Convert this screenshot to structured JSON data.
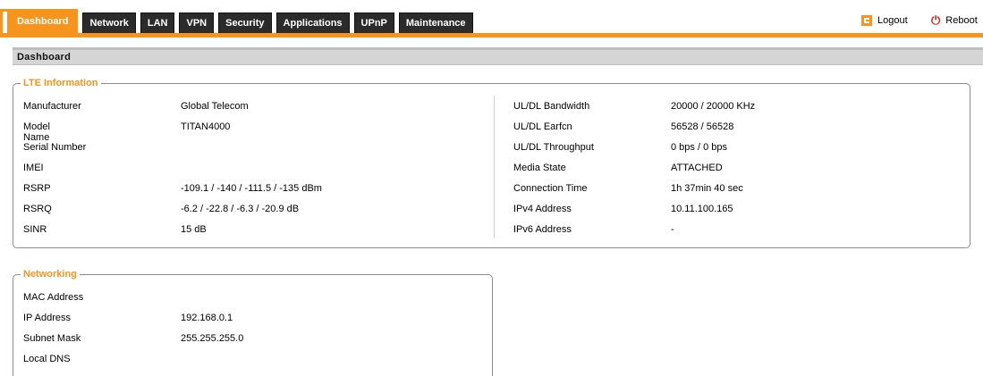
{
  "nav": {
    "tabs": [
      "Dashboard",
      "Network",
      "LAN",
      "VPN",
      "Security",
      "Applications",
      "UPnP",
      "Maintenance"
    ],
    "active_tab": "Dashboard",
    "logout_label": "Logout",
    "reboot_label": "Reboot"
  },
  "page": {
    "section_title": "Dashboard"
  },
  "lte": {
    "legend": "LTE Information",
    "left": [
      {
        "label": "Manufacturer",
        "value": "Global Telecom"
      },
      {
        "label": "Model Name",
        "value": "TITAN4000"
      },
      {
        "label": "Serial Number",
        "value": ""
      },
      {
        "label": "IMEI",
        "value": ""
      },
      {
        "label": "RSRP",
        "value": "-109.1 / -140 / -111.5 / -135 dBm"
      },
      {
        "label": "RSRQ",
        "value": "-6.2 / -22.8 / -6.3 / -20.9 dB"
      },
      {
        "label": "SINR",
        "value": "15 dB"
      }
    ],
    "right": [
      {
        "label": "UL/DL Bandwidth",
        "value": "20000 / 20000 KHz"
      },
      {
        "label": "UL/DL Earfcn",
        "value": "56528 / 56528"
      },
      {
        "label": "UL/DL Throughput",
        "value": "0 bps / 0 bps"
      },
      {
        "label": "Media State",
        "value": "ATTACHED"
      },
      {
        "label": "Connection Time",
        "value": "1h 37min 40 sec"
      },
      {
        "label": "IPv4 Address",
        "value": "10.11.100.165"
      },
      {
        "label": "IPv6 Address",
        "value": "-"
      }
    ]
  },
  "networking": {
    "legend": "Networking",
    "rows": [
      {
        "label": "MAC Address",
        "value": ""
      },
      {
        "label": "IP Address",
        "value": "192.168.0.1"
      },
      {
        "label": "Subnet Mask",
        "value": "255.255.255.0"
      },
      {
        "label": "Local DNS",
        "value": ""
      }
    ]
  },
  "colors": {
    "accent": "#f7941d",
    "tab_bg": "#2b2b2b",
    "reboot_icon": "#d9231b"
  }
}
